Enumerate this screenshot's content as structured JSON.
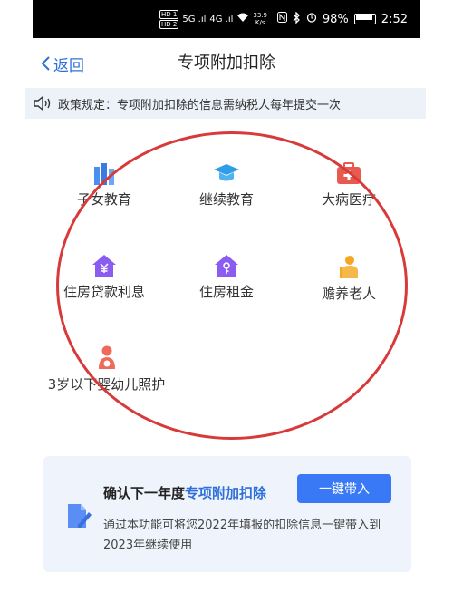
{
  "status_bar": {
    "hd1": "HD 1",
    "hd2": "HD 2",
    "signal1": "5G .ıl",
    "signal2": "4G .ıl",
    "speed_value": "33.9",
    "speed_unit": "K/s",
    "battery": "98%",
    "time": "2:52"
  },
  "nav": {
    "back_label": "返回",
    "title": "专项附加扣除"
  },
  "policy": {
    "text": "政策规定：专项附加扣除的信息需纳税人每年提交一次"
  },
  "items": [
    {
      "label": "子女教育",
      "icon": "children-education-icon",
      "color": "#4a8ff0"
    },
    {
      "label": "继续教育",
      "icon": "graduation-cap-icon",
      "color": "#2f9de8"
    },
    {
      "label": "大病医疗",
      "icon": "medical-kit-icon",
      "color": "#e85a4f"
    },
    {
      "label": "住房贷款利息",
      "icon": "house-yuan-icon",
      "color": "#8a5cf0"
    },
    {
      "label": "住房租金",
      "icon": "house-key-icon",
      "color": "#8a5cf0"
    },
    {
      "label": "赡养老人",
      "icon": "elderly-person-icon",
      "color": "#f5a623"
    },
    {
      "label": "3岁以下婴幼儿照护",
      "icon": "mother-baby-icon",
      "color": "#ef6a5a"
    }
  ],
  "card": {
    "title_prefix": "确认下一年度",
    "title_highlight": "专项附加扣除",
    "button_label": "一键带入",
    "description": "通过本功能可将您2022年填报的扣除信息一键带入到2023年继续使用"
  },
  "colors": {
    "accent": "#2f6fd9",
    "button": "#3979f5",
    "annotation": "#d83a3a"
  }
}
